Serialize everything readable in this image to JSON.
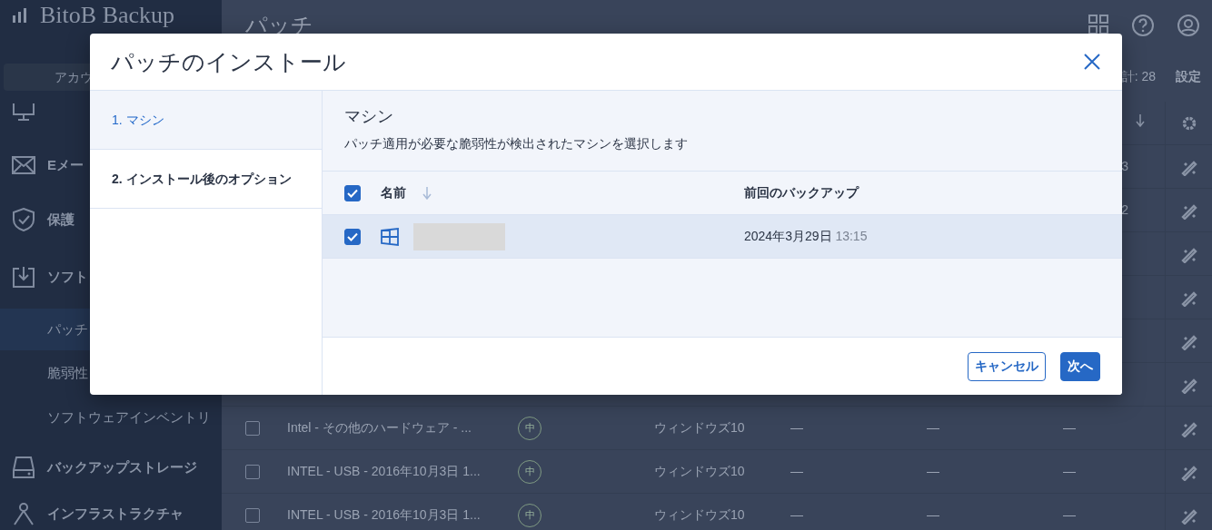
{
  "app": {
    "logo": "BitoB Backup",
    "page_title": "パッチ",
    "account_button": "アカウ",
    "sidebar": {
      "items": [
        {
          "kind": "section"
        },
        {
          "kind": "section",
          "label": "Eメー"
        },
        {
          "kind": "section",
          "label": "保護"
        },
        {
          "kind": "section",
          "label": "ソフト"
        },
        {
          "kind": "sub",
          "label": "パッチ",
          "selected": true
        },
        {
          "kind": "sub",
          "label": "脆弱性",
          "selected": false
        },
        {
          "kind": "sub",
          "label": "ソフトウェアインベントリ",
          "selected": false
        },
        {
          "kind": "section",
          "label": "バックアップストレージ"
        },
        {
          "kind": "section",
          "label": "インフラストラクチャ"
        }
      ]
    },
    "toolbar": {
      "total": "計: 28",
      "settings": "設定"
    },
    "table": {
      "rows": [
        {
          "kind": "covered",
          "column_7": "3"
        },
        {
          "kind": "covered",
          "column_7": "2"
        },
        {
          "kind": "covered"
        },
        {
          "kind": "covered"
        },
        {
          "kind": "covered"
        },
        {
          "kind": "covered"
        },
        {
          "kind": "full",
          "checked": false,
          "name": "Intel - その他のハードウェア - ...",
          "severity": "中",
          "os": "ウィンドウズ10",
          "column_5": "—",
          "column_6": "—",
          "column_7": "—"
        },
        {
          "kind": "full",
          "checked": false,
          "name": "INTEL - USB - 2016年10月3日 1...",
          "severity": "中",
          "os": "ウィンドウズ10",
          "column_5": "—",
          "column_6": "—",
          "column_7": "—"
        },
        {
          "kind": "full",
          "checked": false,
          "name": "INTEL - USB - 2016年10月3日 1...",
          "severity": "中",
          "os": "ウィンドウズ10",
          "column_5": "—",
          "column_6": "—",
          "column_7": "—"
        }
      ]
    }
  },
  "dialog": {
    "title": "パッチのインストール",
    "steps": [
      {
        "label": "1. マシン",
        "selected": true
      },
      {
        "label": "2. インストール後のオプション",
        "selected": false
      }
    ],
    "heading": "マシン",
    "description": "パッチ適用が必要な脆弱性が検出されたマシンを選択します",
    "table": {
      "select_all_checked": true,
      "columns": [
        "名前",
        "前回のバックアップ"
      ],
      "rows": [
        {
          "checked": true,
          "selected": true,
          "last_backup_date": "2024年3月29日",
          "last_backup_time": "13:15"
        }
      ]
    },
    "buttons": [
      {
        "label": "キャンセル",
        "kind": "secondary"
      },
      {
        "label": "次へ",
        "kind": "primary"
      }
    ]
  }
}
